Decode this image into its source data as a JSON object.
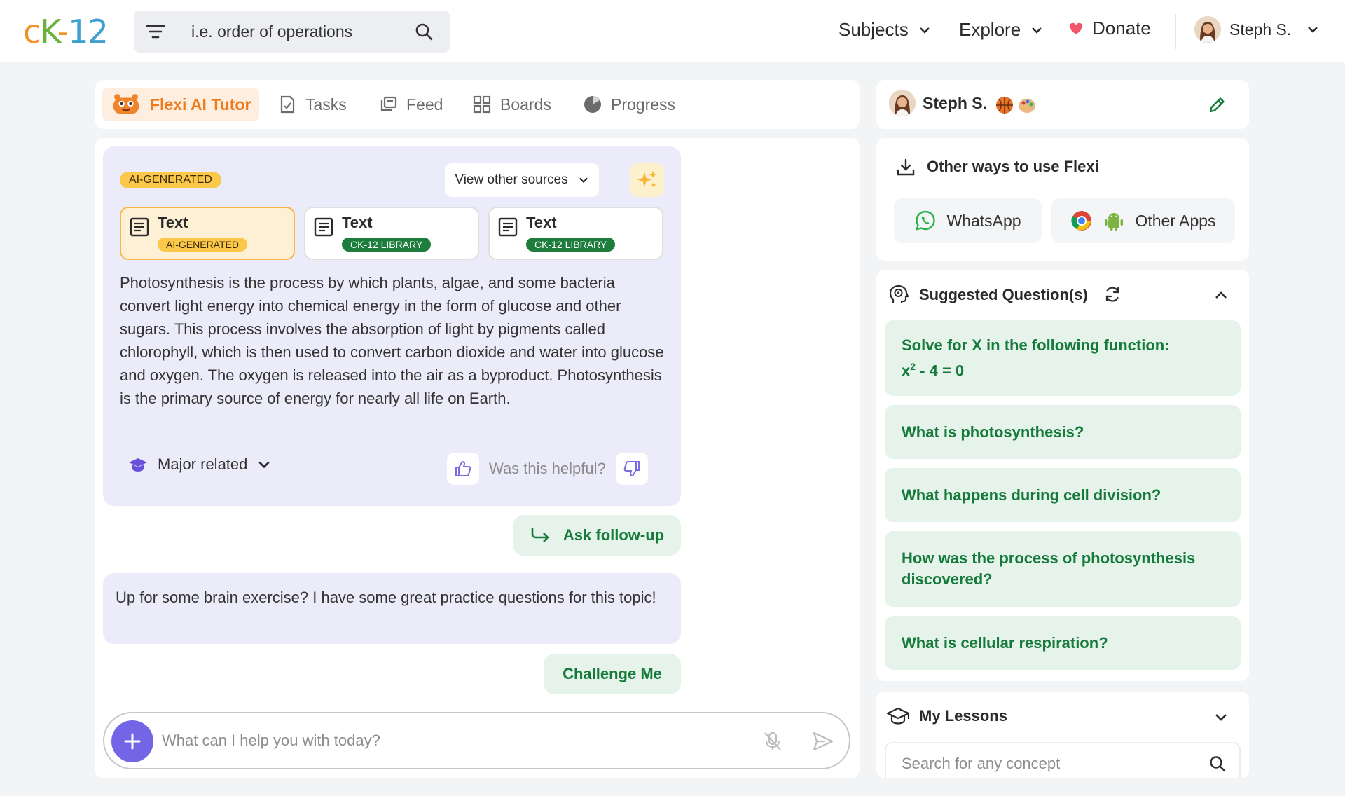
{
  "header": {
    "logo": {
      "c": "c",
      "k": "K",
      "dash": "-",
      "num": "12"
    },
    "search_placeholder": "i.e. order of operations",
    "nav": {
      "subjects": "Subjects",
      "explore": "Explore",
      "donate": "Donate"
    },
    "user_name": "Steph S."
  },
  "tabs": [
    {
      "label": "Flexi AI Tutor",
      "icon": "flexi-mascot-icon",
      "active": true
    },
    {
      "label": "Tasks",
      "icon": "tasks-icon"
    },
    {
      "label": "Feed",
      "icon": "feed-icon"
    },
    {
      "label": "Boards",
      "icon": "boards-icon"
    },
    {
      "label": "Progress",
      "icon": "progress-icon"
    }
  ],
  "answer": {
    "badge": "AI-GENERATED",
    "view_sources": "View other sources",
    "sources": [
      {
        "title": "Text",
        "badge": "AI-GENERATED"
      },
      {
        "title": "Text",
        "badge": "CK-12 LIBRARY"
      },
      {
        "title": "Text",
        "badge": "CK-12 LIBRARY"
      }
    ],
    "text": "Photosynthesis is the process by which plants, algae, and some bacteria convert light energy into chemical energy in the form of glucose and other sugars. This process involves the absorption of light by pigments called chlorophyll, which is then used to convert carbon dioxide and water into glucose and oxygen. The oxygen is released into the air as a byproduct. Photosynthesis is the primary source of energy for nearly all life on Earth.",
    "major_related": "Major related",
    "helpful": "Was this helpful?"
  },
  "follow_up": "Ask follow-up",
  "practice_message": "Up for some brain exercise? I have some great practice questions for this topic!",
  "challenge": "Challenge Me",
  "chat_input_placeholder": "What can I help you with today?",
  "profile": {
    "name": "Steph S."
  },
  "other_ways": {
    "title": "Other ways to use Flexi",
    "whatsapp": "WhatsApp",
    "other_apps": "Other Apps"
  },
  "suggested": {
    "title": "Suggested Question(s)",
    "q1_line1": "Solve for X in the following function:",
    "q1_base": "x",
    "q1_exp": "2",
    "q1_rest": " - 4 = 0",
    "questions": [
      "What is photosynthesis?",
      "What happens during cell division?",
      "How was the process of photosynthesis discovered?",
      "What is cellular respiration?"
    ]
  },
  "lessons": {
    "title": "My Lessons",
    "search_placeholder": "Search for any concept"
  },
  "colors": {
    "accent_green": "#157a3a",
    "accent_orange": "#f07a1a",
    "accent_purple": "#7265e6"
  }
}
